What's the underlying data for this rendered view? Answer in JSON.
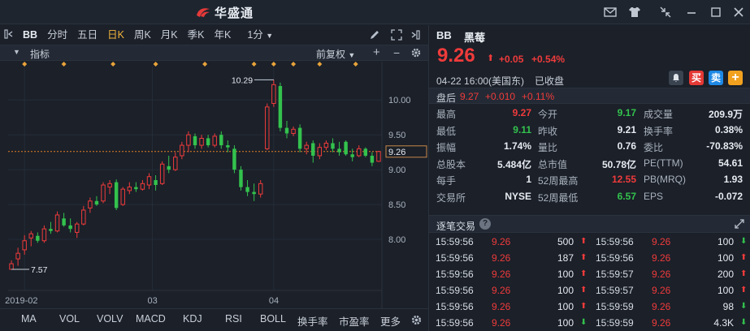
{
  "app": {
    "name": "华盛通"
  },
  "toolbar": {
    "symbol": "BB",
    "periods": [
      {
        "label": "分时",
        "active": false
      },
      {
        "label": "五日",
        "active": false
      },
      {
        "label": "日K",
        "active": true
      },
      {
        "label": "周K",
        "active": false
      },
      {
        "label": "月K",
        "active": false
      },
      {
        "label": "季K",
        "active": false
      },
      {
        "label": "年K",
        "active": false
      }
    ],
    "interval": "1分"
  },
  "indicator_bar": {
    "label": "指标",
    "adjust": "前复权"
  },
  "chart_data": {
    "type": "candlestick",
    "x_ticks": [
      "2019-02",
      "03",
      "04"
    ],
    "y_ticks": [
      10.0,
      9.5,
      9.0,
      8.5,
      8.0
    ],
    "ylim": [
      7.36,
      10.48
    ],
    "current_price": 9.26,
    "annotations": {
      "high": "10.29",
      "low": "7.57"
    },
    "colors": {
      "up": "#ef3b3b",
      "down": "#33c24d",
      "price_line": "#e67e22",
      "marker": "#e8a33a"
    },
    "candles": [
      {
        "o": 7.57,
        "h": 7.7,
        "l": 7.57,
        "c": 7.65
      },
      {
        "o": 7.72,
        "h": 7.88,
        "l": 7.62,
        "c": 7.8
      },
      {
        "o": 7.85,
        "h": 8.06,
        "l": 7.78,
        "c": 7.98
      },
      {
        "o": 8.02,
        "h": 8.12,
        "l": 7.9,
        "c": 8.08
      },
      {
        "o": 8.05,
        "h": 8.1,
        "l": 7.95,
        "c": 7.98
      },
      {
        "o": 7.98,
        "h": 8.2,
        "l": 7.95,
        "c": 8.15
      },
      {
        "o": 8.15,
        "h": 8.25,
        "l": 8.08,
        "c": 8.12
      },
      {
        "o": 8.12,
        "h": 8.4,
        "l": 8.1,
        "c": 8.35
      },
      {
        "o": 8.3,
        "h": 8.38,
        "l": 8.18,
        "c": 8.2
      },
      {
        "o": 8.2,
        "h": 8.3,
        "l": 8.1,
        "c": 8.15
      },
      {
        "o": 8.1,
        "h": 8.25,
        "l": 8.02,
        "c": 8.22
      },
      {
        "o": 8.22,
        "h": 8.48,
        "l": 8.2,
        "c": 8.42
      },
      {
        "o": 8.45,
        "h": 8.6,
        "l": 8.38,
        "c": 8.55
      },
      {
        "o": 8.55,
        "h": 8.62,
        "l": 8.48,
        "c": 8.5
      },
      {
        "o": 8.55,
        "h": 8.82,
        "l": 8.52,
        "c": 8.78
      },
      {
        "o": 8.75,
        "h": 8.85,
        "l": 8.65,
        "c": 8.8
      },
      {
        "o": 8.82,
        "h": 8.86,
        "l": 8.42,
        "c": 8.45
      },
      {
        "o": 8.5,
        "h": 8.75,
        "l": 8.48,
        "c": 8.72
      },
      {
        "o": 8.7,
        "h": 8.82,
        "l": 8.65,
        "c": 8.75
      },
      {
        "o": 8.75,
        "h": 8.82,
        "l": 8.68,
        "c": 8.72
      },
      {
        "o": 8.72,
        "h": 8.85,
        "l": 8.7,
        "c": 8.8
      },
      {
        "o": 8.78,
        "h": 8.95,
        "l": 8.72,
        "c": 8.9
      },
      {
        "o": 8.85,
        "h": 8.92,
        "l": 8.7,
        "c": 8.78
      },
      {
        "o": 8.8,
        "h": 9.12,
        "l": 8.78,
        "c": 9.08
      },
      {
        "o": 9.05,
        "h": 9.2,
        "l": 8.95,
        "c": 9.0
      },
      {
        "o": 9.0,
        "h": 9.25,
        "l": 8.98,
        "c": 9.18
      },
      {
        "o": 9.2,
        "h": 9.4,
        "l": 9.15,
        "c": 9.35
      },
      {
        "o": 9.35,
        "h": 9.55,
        "l": 9.25,
        "c": 9.5
      },
      {
        "o": 9.48,
        "h": 9.52,
        "l": 9.3,
        "c": 9.35
      },
      {
        "o": 9.35,
        "h": 9.5,
        "l": 9.3,
        "c": 9.45
      },
      {
        "o": 9.45,
        "h": 9.5,
        "l": 9.32,
        "c": 9.35
      },
      {
        "o": 9.35,
        "h": 9.52,
        "l": 9.32,
        "c": 9.48
      },
      {
        "o": 9.5,
        "h": 9.55,
        "l": 9.3,
        "c": 9.35
      },
      {
        "o": 9.35,
        "h": 9.42,
        "l": 9.25,
        "c": 9.32
      },
      {
        "o": 9.3,
        "h": 9.35,
        "l": 8.95,
        "c": 9.0
      },
      {
        "o": 9.0,
        "h": 9.05,
        "l": 8.7,
        "c": 8.75
      },
      {
        "o": 8.75,
        "h": 8.85,
        "l": 8.62,
        "c": 8.68
      },
      {
        "o": 8.68,
        "h": 8.8,
        "l": 8.55,
        "c": 8.65
      },
      {
        "o": 8.65,
        "h": 8.85,
        "l": 8.6,
        "c": 8.8
      },
      {
        "o": 9.3,
        "h": 9.95,
        "l": 9.28,
        "c": 9.9
      },
      {
        "o": 9.95,
        "h": 10.29,
        "l": 9.9,
        "c": 10.22
      },
      {
        "o": 10.2,
        "h": 10.25,
        "l": 9.55,
        "c": 9.6
      },
      {
        "o": 9.6,
        "h": 9.7,
        "l": 9.45,
        "c": 9.52
      },
      {
        "o": 9.52,
        "h": 9.62,
        "l": 9.48,
        "c": 9.58
      },
      {
        "o": 9.6,
        "h": 9.65,
        "l": 9.25,
        "c": 9.3
      },
      {
        "o": 9.3,
        "h": 9.4,
        "l": 9.22,
        "c": 9.35
      },
      {
        "o": 9.38,
        "h": 9.42,
        "l": 9.1,
        "c": 9.2
      },
      {
        "o": 9.2,
        "h": 9.38,
        "l": 9.15,
        "c": 9.32
      },
      {
        "o": 9.32,
        "h": 9.42,
        "l": 9.28,
        "c": 9.38
      },
      {
        "o": 9.38,
        "h": 9.45,
        "l": 9.25,
        "c": 9.3
      },
      {
        "o": 9.3,
        "h": 9.4,
        "l": 9.2,
        "c": 9.25
      },
      {
        "o": 9.4,
        "h": 9.42,
        "l": 9.2,
        "c": 9.22
      },
      {
        "o": 9.22,
        "h": 9.3,
        "l": 9.12,
        "c": 9.18
      },
      {
        "o": 9.2,
        "h": 9.35,
        "l": 9.18,
        "c": 9.3
      },
      {
        "o": 9.3,
        "h": 9.32,
        "l": 9.18,
        "c": 9.2
      },
      {
        "o": 9.2,
        "h": 9.25,
        "l": 9.05,
        "c": 9.1
      },
      {
        "o": 9.12,
        "h": 9.27,
        "l": 9.11,
        "c": 9.26
      }
    ]
  },
  "bottom_tabs": [
    "MA",
    "VOL",
    "VOLV",
    "MACD",
    "KDJ",
    "RSI",
    "BOLL",
    "换手率",
    "市盈率",
    "更多"
  ],
  "quote": {
    "symbol": "BB",
    "name": "黑莓",
    "price": "9.26",
    "change": "+0.05",
    "change_pct": "+0.54%",
    "datetime": "04-22 16:00(美国东)",
    "status": "已收盘",
    "after_hours": {
      "label": "盘后",
      "price": "9.27",
      "change": "+0.010",
      "pct": "+0.11%"
    },
    "actions": {
      "buy": "买",
      "sell": "卖",
      "add": "+"
    },
    "stats": [
      [
        {
          "label": "最高",
          "value": "9.27",
          "color": "red"
        },
        {
          "label": "今开",
          "value": "9.17",
          "color": "green"
        },
        {
          "label": "成交量",
          "value": "209.9万",
          "color": "white"
        }
      ],
      [
        {
          "label": "最低",
          "value": "9.11",
          "color": "green"
        },
        {
          "label": "昨收",
          "value": "9.21",
          "color": "white"
        },
        {
          "label": "换手率",
          "value": "0.38%",
          "color": "white"
        }
      ],
      [
        {
          "label": "振幅",
          "value": "1.74%",
          "color": "white"
        },
        {
          "label": "量比",
          "value": "0.76",
          "color": "white"
        },
        {
          "label": "委比",
          "value": "-70.83%",
          "color": "white"
        }
      ],
      [
        {
          "label": "总股本",
          "value": "5.484亿",
          "color": "white"
        },
        {
          "label": "总市值",
          "value": "50.78亿",
          "color": "white"
        },
        {
          "label": "PE(TTM)",
          "value": "54.61",
          "color": "white"
        }
      ],
      [
        {
          "label": "每手",
          "value": "1",
          "color": "white"
        },
        {
          "label": "52周最高",
          "value": "12.55",
          "color": "red"
        },
        {
          "label": "PB(MRQ)",
          "value": "1.93",
          "color": "white"
        }
      ],
      [
        {
          "label": "交易所",
          "value": "NYSE",
          "color": "white"
        },
        {
          "label": "52周最低",
          "value": "6.57",
          "color": "green"
        },
        {
          "label": "EPS",
          "value": "-0.072",
          "color": "white"
        }
      ]
    ]
  },
  "trades": {
    "title": "逐笔交易",
    "left": [
      {
        "time": "15:59:56",
        "price": "9.26",
        "vol": "500",
        "dir": "up"
      },
      {
        "time": "15:59:56",
        "price": "9.26",
        "vol": "187",
        "dir": "up"
      },
      {
        "time": "15:59:56",
        "price": "9.26",
        "vol": "100",
        "dir": "up"
      },
      {
        "time": "15:59:56",
        "price": "9.26",
        "vol": "100",
        "dir": "up"
      },
      {
        "time": "15:59:56",
        "price": "9.26",
        "vol": "100",
        "dir": "up"
      },
      {
        "time": "15:59:56",
        "price": "9.26",
        "vol": "100",
        "dir": "down"
      }
    ],
    "right": [
      {
        "time": "15:59:56",
        "price": "9.26",
        "vol": "100",
        "dir": "down"
      },
      {
        "time": "15:59:56",
        "price": "9.26",
        "vol": "100",
        "dir": "up"
      },
      {
        "time": "15:59:57",
        "price": "9.26",
        "vol": "200",
        "dir": "up"
      },
      {
        "time": "15:59:57",
        "price": "9.26",
        "vol": "100",
        "dir": "up"
      },
      {
        "time": "15:59:59",
        "price": "9.26",
        "vol": "98",
        "dir": "down"
      },
      {
        "time": "15:59:59",
        "price": "9.26",
        "vol": "4.3K",
        "dir": "down"
      }
    ]
  }
}
